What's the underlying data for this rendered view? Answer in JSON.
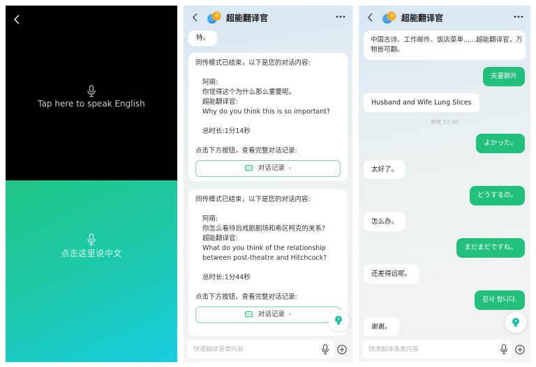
{
  "voice_panel": {
    "english_prompt": "Tap here to speak English",
    "chinese_prompt": "点击这里说中文",
    "colors": {
      "top_bg": "#000000",
      "bottom_gradient_start": "#22c585",
      "bottom_gradient_end": "#18cde0"
    }
  },
  "app": {
    "title": "超能翻译官",
    "accent": "#22c07c",
    "input_placeholder": "快速翻译各类内容"
  },
  "middle_chat": {
    "partial_bubble": "特。",
    "summaries": [
      {
        "intro": "同传模式已结束，以下是您的对话内容:",
        "speaker1": "阿萌:",
        "speaker1_text": "你觉得这个为什么那么重要呢。",
        "speaker2": "超能翻译官:",
        "speaker2_lines": [
          "Why do you think this is so important?"
        ],
        "duration": "总时长:1分14秒",
        "cta": "点击下方按钮，查看完整对话记录:",
        "button": "对话记录",
        "button_chevron": "›"
      },
      {
        "intro": "同传模式已结束，以下是您的对话内容:",
        "speaker1": "阿萌:",
        "speaker1_text": "你怎么看待后戏剧剧场和希区柯克的关系?",
        "speaker2": "超能翻译官:",
        "speaker2_lines": [
          "What do you think of the relationship",
          "between post-theatre and Hitchcock?"
        ],
        "duration": "总时长:1分44秒",
        "cta": "点击下方按钮，查看完整对话记录:",
        "button": "对话记录",
        "button_chevron": "›"
      }
    ]
  },
  "right_chat": {
    "intro_lines": [
      "中国古诗、工作邮件、饭店菜单......超能翻译官，万",
      "物皆可翻。"
    ],
    "messages": [
      {
        "side": "right",
        "text": "夫妻肺片"
      },
      {
        "side": "left",
        "text": "Husband and Wife Lung Slices"
      },
      {
        "side": "time",
        "text": "昨天 17:30"
      },
      {
        "side": "right",
        "text": "よかった。"
      },
      {
        "side": "left",
        "text": "太好了。"
      },
      {
        "side": "right",
        "text": "どうするの。"
      },
      {
        "side": "left",
        "text": "怎么办。"
      },
      {
        "side": "right",
        "text": "まだまだですね。"
      },
      {
        "side": "left",
        "text": "还差得远呢。"
      },
      {
        "side": "right",
        "text": "감사 합니다."
      },
      {
        "side": "left",
        "text": "谢谢。"
      }
    ]
  }
}
